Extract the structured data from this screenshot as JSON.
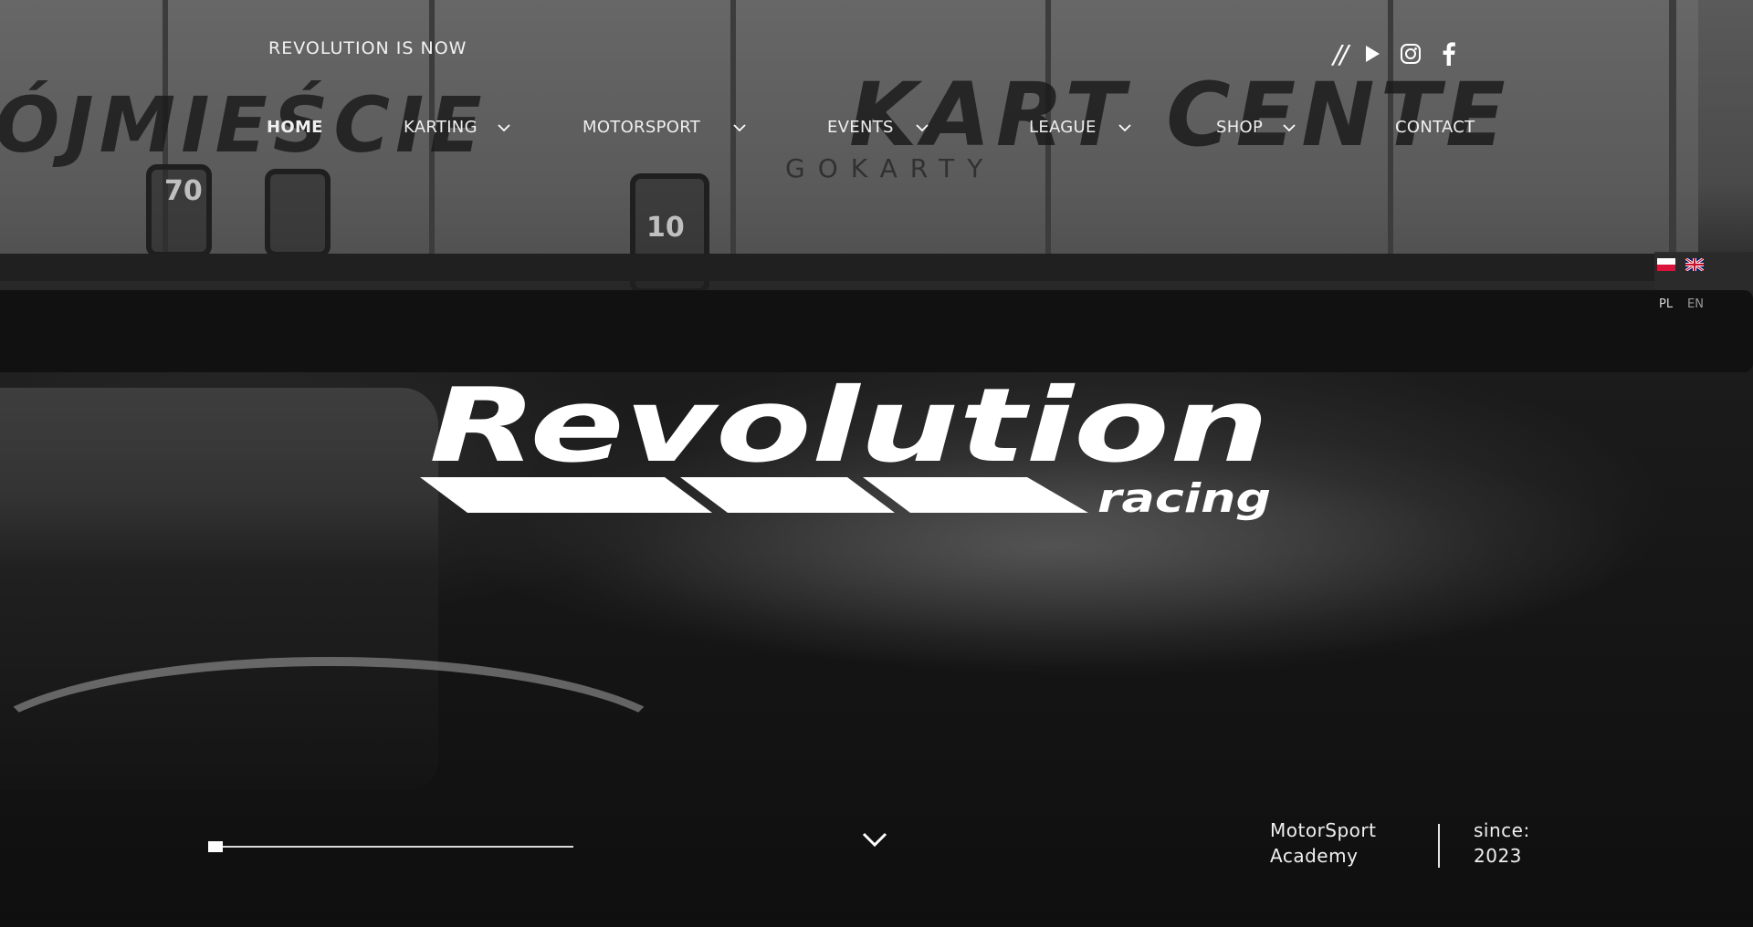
{
  "header": {
    "tagline": "REVOLUTION IS NOW",
    "social_separator": "//",
    "social_icons": [
      "youtube-icon",
      "instagram-icon",
      "facebook-icon"
    ]
  },
  "nav": {
    "items": [
      {
        "label": "HOME",
        "active": true,
        "dropdown": false
      },
      {
        "label": "KARTING",
        "active": false,
        "dropdown": true
      },
      {
        "label": "MOTORSPORT",
        "active": false,
        "dropdown": true
      },
      {
        "label": "EVENTS",
        "active": false,
        "dropdown": true
      },
      {
        "label": "LEAGUE",
        "active": false,
        "dropdown": true
      },
      {
        "label": "SHOP",
        "active": false,
        "dropdown": true
      },
      {
        "label": "CONTACT",
        "active": false,
        "dropdown": false
      }
    ]
  },
  "language": {
    "codes": [
      "PL",
      "EN"
    ],
    "flags": [
      "poland-flag-icon",
      "uk-flag-icon"
    ]
  },
  "background": {
    "banner_texts": [
      "ÓJMIEŚCIE",
      "KART CENTE",
      "GOKARTY"
    ],
    "kart_numbers": [
      "70",
      "10"
    ]
  },
  "logo": {
    "title": "Revolution",
    "subtitle": "racing"
  },
  "footer": {
    "slider_progress": 0,
    "scroll_icon": "chevron-down-icon",
    "academy_line1": "MotorSport",
    "academy_line2": "Academy",
    "since_label": "since:",
    "since_year": "2023"
  },
  "colors": {
    "text": "#ffffff",
    "background": "#0d0d0d"
  }
}
